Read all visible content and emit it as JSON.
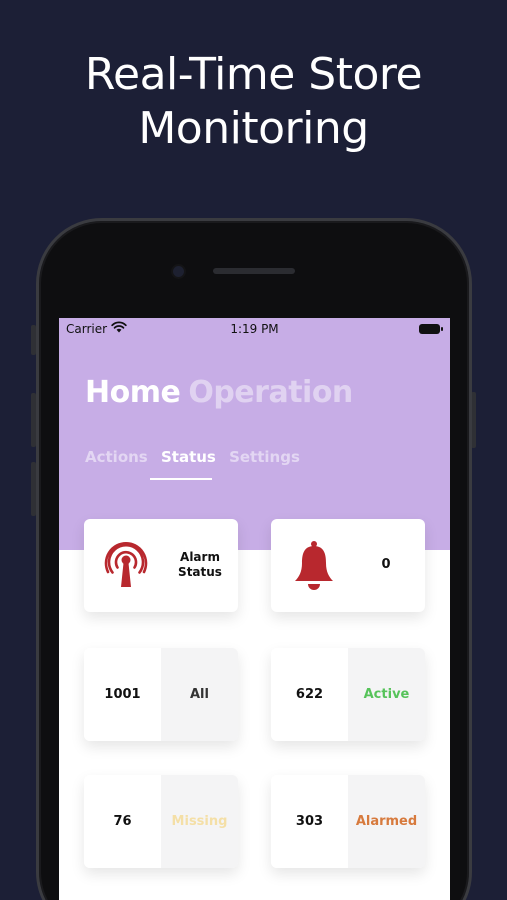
{
  "headline": {
    "line1": "Real-Time Store",
    "line2": "Monitoring"
  },
  "status_bar": {
    "carrier": "Carrier",
    "time": "1:19 PM"
  },
  "header": {
    "title_primary": "Home",
    "title_secondary": "Operation"
  },
  "tabs": [
    {
      "label": "Actions",
      "active": false
    },
    {
      "label": "Status",
      "active": true
    },
    {
      "label": "Settings",
      "active": false
    }
  ],
  "cards": {
    "alarm_status": {
      "label_line1": "Alarm",
      "label_line2": "Status"
    },
    "bell": {
      "count": "0"
    },
    "all": {
      "count": "1001",
      "label": "All"
    },
    "active": {
      "count": "622",
      "label": "Active"
    },
    "missing": {
      "count": "76",
      "label": "Missing"
    },
    "alarmed": {
      "count": "303",
      "label": "Alarmed"
    }
  },
  "colors": {
    "background": "#1c1f36",
    "header_purple": "#c7ade6",
    "alarm_red": "#b8282e",
    "active_green": "#56c35a",
    "missing_yellow": "#f4dfa6",
    "alarmed_orange": "#d77a3d"
  },
  "icons": [
    "wifi-icon",
    "battery-icon",
    "alarm-tower-icon",
    "bell-icon"
  ]
}
